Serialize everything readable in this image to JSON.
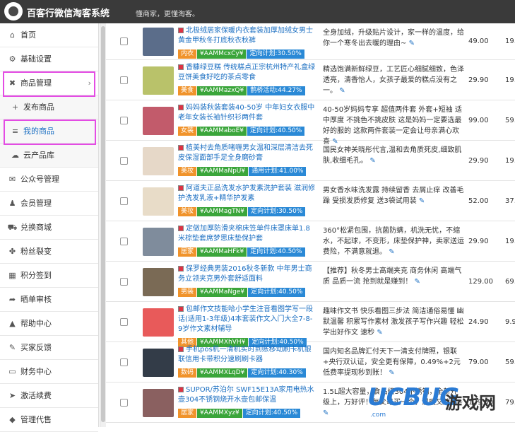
{
  "header": {
    "title": "百客行微信淘客系统",
    "subtitle": "懂商家，更懂淘客。"
  },
  "sidebar": {
    "items": [
      {
        "label": "首页",
        "icon": "home-icon",
        "glyph": "⌂"
      },
      {
        "label": "基础设置",
        "icon": "gear-icon",
        "glyph": "⚙"
      },
      {
        "label": "商品管理",
        "icon": "tool-icon",
        "glyph": "✖"
      },
      {
        "label": "发布商品",
        "icon": "plus-icon",
        "glyph": "+"
      },
      {
        "label": "我的商品",
        "icon": "list-icon",
        "glyph": "≡"
      },
      {
        "label": "云产品库",
        "icon": "cloud-icon",
        "glyph": "☁"
      },
      {
        "label": "公众号管理",
        "icon": "wechat-icon",
        "glyph": "✉"
      },
      {
        "label": "会员管理",
        "icon": "users-icon",
        "glyph": "♟"
      },
      {
        "label": "兑换商城",
        "icon": "cart-icon",
        "glyph": "⛟"
      },
      {
        "label": "粉丝裂变",
        "icon": "network-icon",
        "glyph": "✤"
      },
      {
        "label": "积分签到",
        "icon": "calendar-icon",
        "glyph": "▦"
      },
      {
        "label": "晒单审核",
        "icon": "share-icon",
        "glyph": "➦"
      },
      {
        "label": "帮助中心",
        "icon": "graduation-icon",
        "glyph": "▲"
      },
      {
        "label": "买家反馈",
        "icon": "comments-icon",
        "glyph": "✎"
      },
      {
        "label": "财务中心",
        "icon": "card-icon",
        "glyph": "▭"
      },
      {
        "label": "激活续费",
        "icon": "send-icon",
        "glyph": "➤"
      },
      {
        "label": "管理代售",
        "icon": "bag-icon",
        "glyph": "◆"
      }
    ]
  },
  "colors": {
    "accent": "#1b6fc2",
    "highlight": "#e44ce4",
    "tag_category": "#f0932b",
    "tag_code": "#3aa53a",
    "tag_plan": "#2a89d6",
    "topbar": "#3a3a3a"
  },
  "products": [
    {
      "title": "北极绒居家保暖内衣套装加厚加绒女男士黄金甲秋冬打底秋衣秋裤",
      "category": "内衣",
      "code": "¥AAMMcxCy¥",
      "plan": "定向计划:30.50%",
      "desc": "全身加绒，升级贴片设计，家一样的温度，给你一个寒冬出去暖的理由~",
      "price": "49.00",
      "price2": "19."
    },
    {
      "title": "香糠绿豆糕 传统糕点正宗杭州特产礼盒绿豆饼美食好吃的茶点零食",
      "category": "美食",
      "code": "¥AAMMazxQ¥",
      "plan": "鹊桥活动:44.27%",
      "desc": "精选饱满新鲜绿豆，工艺匠心细腻细致，色泽透亮，清香怡人，女孩子最爱的糕点没有之一。",
      "price": "29.90",
      "price2": "19."
    },
    {
      "title": "妈妈装秋装套装40-50岁 中年妇女衣服中老年女装长袖针织衫两件套",
      "category": "女装",
      "code": "¥AAMMaboE¥",
      "plan": "定向计划:40.50%",
      "desc": "40-50岁妈妈专享 超值两件套 外套+短袖 适中厚度 不挑色不挑皮肤 这是妈妈一定要选最好的服的 这款两件套装一定会让母亲满心欢喜",
      "price": "99.00",
      "price2": "59."
    },
    {
      "title": "植美村去角质啫喱男女温和深层清洁去死皮保湿面部手足全身磨砂膏",
      "category": "美妆",
      "code": "¥AAMMaNpU¥",
      "plan": "通用计划:41.00%",
      "desc": "国民女神关晓彤代言,温和去角质死皮,细致肌肤,收细毛孔。",
      "price": "29.90",
      "price2": "19."
    },
    {
      "title": "阿道夫正品洗发水护发素洗护套装 滋润修护洗发乳液+精华护发素",
      "category": "美妆",
      "code": "¥AAMMagTN¥",
      "plan": "定向计划:30.50%",
      "desc": "男女香水味洗发露 持续留香 去屑止痒 改善毛躁 受损发质修复 送3袋试用装",
      "price": "52.00",
      "price2": "37."
    },
    {
      "title": "定做加厚防滑夹棉床笠单件床罩床单1.8米棕垫套席梦思床垫保护套",
      "category": "居家",
      "code": "¥AAMMaHFk¥",
      "plan": "定向计划:40.50%",
      "desc": "360°松紧包围，抗菌防螨，机洗无忧，不缩水，不起球，不变形，床垫保护神，卖家送运费险，不满意就退。",
      "price": "29.90",
      "price2": "19."
    },
    {
      "title": "保罗经典男装2016秋冬新款 中年男士商务立领夹克男外套舒适面料",
      "category": "男装",
      "code": "¥AAMMaNge¥",
      "plan": "定向计划:40.50%",
      "desc": "【推荐】秋冬男士高端夹克 商务休闲 高端气质 品质一流 抢到就是赚到！",
      "price": "129.00",
      "price2": "69."
    },
    {
      "title": "包邮作文技能哈小学生注音看图学写一段话(适用1-3年级)4本套装作文入门大全7-8-9岁作文素材辅导",
      "category": "其他",
      "code": "¥AAMMXhVH¥",
      "plan": "定向计划:40.50%",
      "desc": "趣味作文书 快乐看图三步法 简洁通俗易懂 幽默温馨 积累写作素材 激发孩子写作兴趣 轻松学出好作文 速秒",
      "price": "24.90",
      "price2": "9.9"
    },
    {
      "title": "手机pos机一清机实时到账移动刷卡机银联信用卡带积分速刷刷卡器",
      "category": "数码",
      "code": "¥AAMMXLqD¥",
      "plan": "定向计划:40.30%",
      "desc": "国内知名品牌汇付天下一清支付牌照，银联+央行双认证，安全更有保障，0.49%+2元低费率提现秒到账！",
      "price": "79.00",
      "price2": "59."
    },
    {
      "title": "SUPOR/苏泊尔 SWF15E13A家用电热水壶304不锈钢烧开水壶包邮保温",
      "category": "居家",
      "code": "¥AAMMXyz¥",
      "plan": "定向计划:40.50%",
      "desc": "1.5L超大容量，食品级304不锈钢，全新升级上，万好评！每父母买一个，温暖又贴心~",
      "price": "129.00",
      "price2": "79."
    }
  ],
  "watermark": {
    "brand": "UCBUG",
    "game": "游戏网",
    "url": ".com"
  }
}
